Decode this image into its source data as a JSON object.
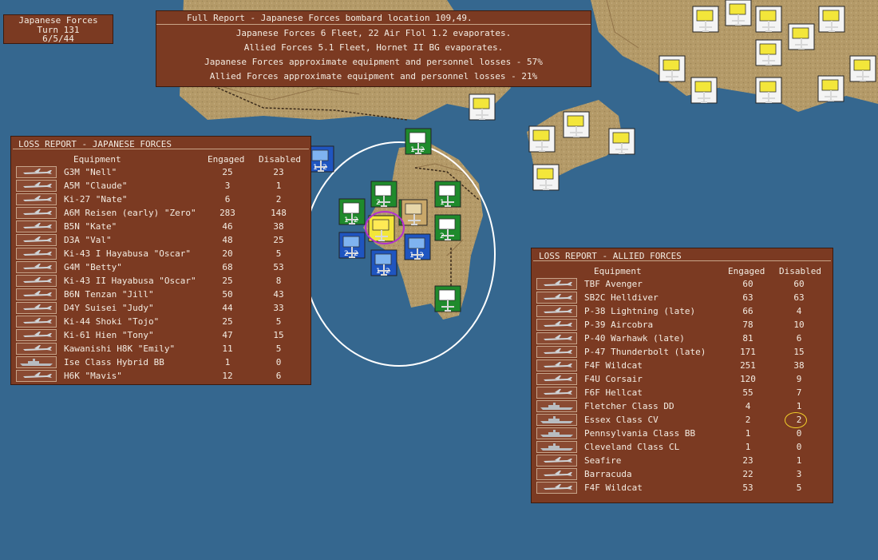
{
  "turn_box": {
    "side": "Japanese Forces",
    "turn": "Turn 131",
    "date": "6/5/44"
  },
  "full_report": {
    "header": "Full Report -  Japanese Forces bombard location 109,49.",
    "lines": [
      "Japanese Forces 6 Fleet, 22 Air Flol 1.2 evaporates.",
      "Allied Forces 5.1 Fleet, Hornet II BG evaporates.",
      "Japanese Forces approximate equipment and personnel losses - 57%",
      "Allied Forces approximate equipment and personnel losses - 21%"
    ]
  },
  "japanese_loss": {
    "title": "LOSS REPORT -  JAPANESE FORCES",
    "col_equipment": "Equipment",
    "col_engaged": "Engaged",
    "col_disabled": "Disabled",
    "rows": [
      {
        "name": "G3M \"Nell\"",
        "engaged": "25",
        "disabled": "23",
        "icon": "aircraft-icon"
      },
      {
        "name": "A5M \"Claude\"",
        "engaged": "3",
        "disabled": "1",
        "icon": "aircraft-icon"
      },
      {
        "name": "Ki-27 \"Nate\"",
        "engaged": "6",
        "disabled": "2",
        "icon": "aircraft-icon"
      },
      {
        "name": "A6M Reisen (early) \"Zero\"",
        "engaged": "283",
        "disabled": "148",
        "icon": "aircraft-icon"
      },
      {
        "name": "B5N \"Kate\"",
        "engaged": "46",
        "disabled": "38",
        "icon": "aircraft-icon"
      },
      {
        "name": "D3A \"Val\"",
        "engaged": "48",
        "disabled": "25",
        "icon": "aircraft-icon"
      },
      {
        "name": "Ki-43 I Hayabusa \"Oscar\"",
        "engaged": "20",
        "disabled": "5",
        "icon": "aircraft-icon"
      },
      {
        "name": "G4M \"Betty\"",
        "engaged": "68",
        "disabled": "53",
        "icon": "aircraft-icon"
      },
      {
        "name": "Ki-43 II Hayabusa \"Oscar\"",
        "engaged": "25",
        "disabled": "8",
        "icon": "aircraft-icon"
      },
      {
        "name": "B6N Tenzan \"Jill\"",
        "engaged": "50",
        "disabled": "43",
        "icon": "aircraft-icon"
      },
      {
        "name": "D4Y Suisei \"Judy\"",
        "engaged": "44",
        "disabled": "33",
        "icon": "aircraft-icon"
      },
      {
        "name": "Ki-44 Shoki \"Tojo\"",
        "engaged": "25",
        "disabled": "5",
        "icon": "aircraft-icon"
      },
      {
        "name": "Ki-61 Hien \"Tony\"",
        "engaged": "47",
        "disabled": "15",
        "icon": "aircraft-icon"
      },
      {
        "name": "Kawanishi H8K \"Emily\"",
        "engaged": "11",
        "disabled": "5",
        "icon": "aircraft-icon"
      },
      {
        "name": "Ise Class Hybrid BB",
        "engaged": "1",
        "disabled": "0",
        "icon": "ship-icon"
      },
      {
        "name": "H6K \"Mavis\"",
        "engaged": "12",
        "disabled": "6",
        "icon": "aircraft-icon"
      }
    ]
  },
  "allied_loss": {
    "title": "LOSS REPORT -  ALLIED FORCES",
    "col_equipment": "Equipment",
    "col_engaged": "Engaged",
    "col_disabled": "Disabled",
    "rows": [
      {
        "name": "TBF Avenger",
        "engaged": "60",
        "disabled": "60",
        "icon": "aircraft-icon"
      },
      {
        "name": "SB2C Helldiver",
        "engaged": "63",
        "disabled": "63",
        "icon": "aircraft-icon"
      },
      {
        "name": "P-38 Lightning (late)",
        "engaged": "66",
        "disabled": "4",
        "icon": "aircraft-icon"
      },
      {
        "name": "P-39 Aircobra",
        "engaged": "78",
        "disabled": "10",
        "icon": "aircraft-icon"
      },
      {
        "name": "P-40 Warhawk (late)",
        "engaged": "81",
        "disabled": "6",
        "icon": "aircraft-icon"
      },
      {
        "name": "P-47 Thunderbolt (late)",
        "engaged": "171",
        "disabled": "15",
        "icon": "aircraft-icon"
      },
      {
        "name": "F4F Wildcat",
        "engaged": "251",
        "disabled": "38",
        "icon": "aircraft-icon"
      },
      {
        "name": "F4U Corsair",
        "engaged": "120",
        "disabled": "9",
        "icon": "aircraft-icon"
      },
      {
        "name": "F6F Hellcat",
        "engaged": "55",
        "disabled": "7",
        "icon": "aircraft-icon"
      },
      {
        "name": "Fletcher Class DD",
        "engaged": "4",
        "disabled": "1",
        "icon": "ship-icon"
      },
      {
        "name": "Essex Class CV",
        "engaged": "2",
        "disabled": "2",
        "icon": "ship-icon"
      },
      {
        "name": "Pennsylvania Class BB",
        "engaged": "1",
        "disabled": "0",
        "icon": "ship-icon"
      },
      {
        "name": "Cleveland Class CL",
        "engaged": "1",
        "disabled": "0",
        "icon": "ship-icon"
      },
      {
        "name": "Seafire",
        "engaged": "23",
        "disabled": "1",
        "icon": "aircraft-icon"
      },
      {
        "name": "Barracuda",
        "engaged": "22",
        "disabled": "3",
        "icon": "aircraft-icon"
      },
      {
        "name": "F4F Wildcat",
        "engaged": "53",
        "disabled": "5",
        "icon": "aircraft-icon"
      }
    ]
  },
  "map": {
    "units": [
      {
        "kind": "allied-air",
        "labels": [
          "1",
          "2"
        ]
      },
      {
        "kind": "allied-air",
        "labels": [
          "2",
          "2"
        ]
      },
      {
        "kind": "allied-air",
        "labels": [
          "1",
          "2"
        ]
      },
      {
        "kind": "allied-air",
        "labels": [
          "1",
          "3"
        ]
      },
      {
        "kind": "jp-air",
        "labels": [
          "1",
          "2"
        ]
      },
      {
        "kind": "jp-air",
        "labels": [
          "2",
          ""
        ]
      },
      {
        "kind": "jp-air",
        "labels": [
          "1",
          "2"
        ]
      },
      {
        "kind": "jp-air",
        "labels": [
          "1",
          ""
        ]
      },
      {
        "kind": "jp-air",
        "labels": [
          "2",
          ""
        ]
      },
      {
        "kind": "jp-air",
        "labels": [
          "",
          ""
        ]
      },
      {
        "kind": "jp-air",
        "labels": [
          "",
          ""
        ]
      },
      {
        "kind": "jp-hq",
        "labels": [
          "",
          ""
        ]
      },
      {
        "kind": "jp-selected",
        "labels": [
          "",
          ""
        ]
      },
      {
        "kind": "home-air",
        "labels": [
          "",
          ""
        ]
      },
      {
        "kind": "home-air",
        "labels": [
          "",
          ""
        ]
      },
      {
        "kind": "home-air",
        "labels": [
          "",
          ""
        ]
      },
      {
        "kind": "home-air",
        "labels": [
          "",
          ""
        ]
      },
      {
        "kind": "home-air",
        "labels": [
          "",
          ""
        ]
      },
      {
        "kind": "home-air",
        "labels": [
          "",
          ""
        ]
      },
      {
        "kind": "home-air",
        "labels": [
          "",
          ""
        ]
      },
      {
        "kind": "home-air",
        "labels": [
          "",
          ""
        ]
      },
      {
        "kind": "home-air",
        "labels": [
          "",
          ""
        ]
      },
      {
        "kind": "home-air",
        "labels": [
          "",
          ""
        ]
      },
      {
        "kind": "home-air",
        "labels": [
          "",
          ""
        ]
      },
      {
        "kind": "home-ground",
        "labels": [
          "",
          ""
        ]
      },
      {
        "kind": "home-ground",
        "labels": [
          "",
          ""
        ]
      },
      {
        "kind": "home-ground",
        "labels": [
          "",
          ""
        ]
      },
      {
        "kind": "home-ground",
        "labels": [
          "",
          ""
        ]
      },
      {
        "kind": "home-ground",
        "labels": [
          "",
          ""
        ]
      }
    ],
    "colors": {
      "sea": "#35678f",
      "land": "#b9a06d",
      "panel": "#7b3a22",
      "panel_text": "#f3ece2",
      "jp_green": "#1f8a2c",
      "allied_blue": "#1f55c0",
      "home_yellow": "#f3e63a",
      "highlight": "#f3d12a"
    }
  }
}
